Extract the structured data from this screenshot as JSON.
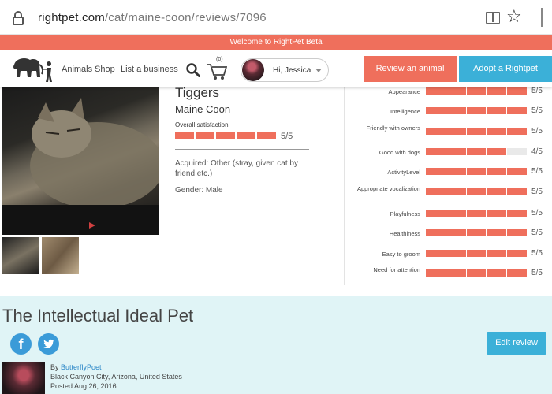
{
  "browser": {
    "url_host": "rightpet.com",
    "url_path": "/cat/maine-coon/reviews/7096"
  },
  "banner": {
    "text": "Welcome to RightPet Beta"
  },
  "nav": {
    "links": [
      "Animals",
      "Shop",
      "List a business"
    ],
    "cart_count": "(0)",
    "user_name": "Hi, Jessica",
    "review_button": "Review an animal",
    "adopt_button": "Adopt a Rightpet"
  },
  "pet": {
    "name": "Tiggers",
    "breed": "Maine Coon",
    "overall_label": "Overall satisfaction",
    "overall_score": "5/5",
    "overall_value": 5,
    "acquired": "Acquired: Other (stray, given cat by friend etc.)",
    "gender": "Gender: Male"
  },
  "ratings": [
    {
      "label": "Appearance",
      "score": "5/5",
      "value": 5
    },
    {
      "label": "Intelligence",
      "score": "5/5",
      "value": 5
    },
    {
      "label": "Friendly with owners",
      "score": "5/5",
      "value": 5
    },
    {
      "label": "Good with dogs",
      "score": "4/5",
      "value": 4
    },
    {
      "label": "ActivityLevel",
      "score": "5/5",
      "value": 5
    },
    {
      "label": "Appropriate vocalization",
      "score": "5/5",
      "value": 5
    },
    {
      "label": "Playfulness",
      "score": "5/5",
      "value": 5
    },
    {
      "label": "Healthiness",
      "score": "5/5",
      "value": 5
    },
    {
      "label": "Easy to groom",
      "score": "5/5",
      "value": 5
    },
    {
      "label": "Need for attention",
      "score": "5/5",
      "value": 5
    }
  ],
  "review": {
    "title": "The Intellectual Ideal Pet",
    "facebook_glyph": "f",
    "edit_button": "Edit review",
    "by_prefix": "By ",
    "author": "ButterflyPoet",
    "location": "Black Canyon City, Arizona, United States",
    "posted": "Posted Aug 26, 2016"
  },
  "colors": {
    "accent": "#ef6f5c",
    "blue": "#3bb0d8",
    "band": "#e0f4f6"
  }
}
